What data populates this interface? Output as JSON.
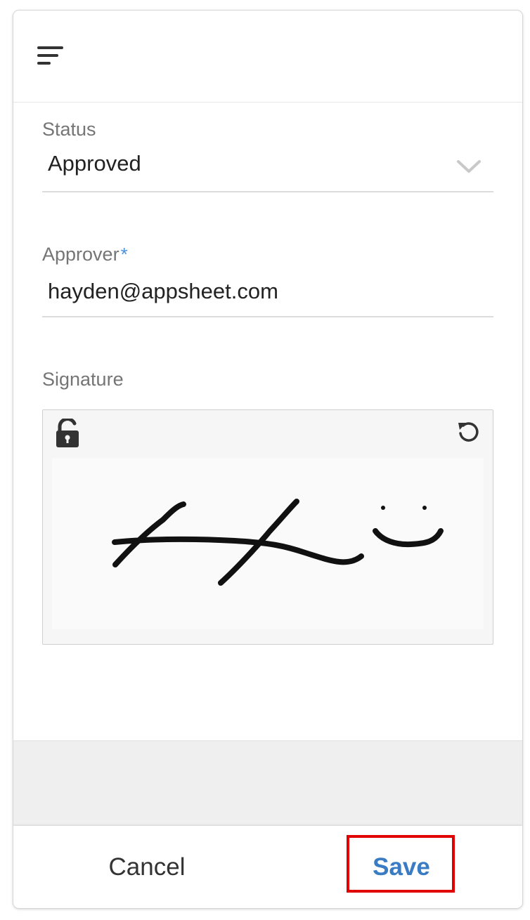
{
  "header": {
    "menu_icon": "menu-icon"
  },
  "form": {
    "status": {
      "label": "Status",
      "value": "Approved",
      "icon": "chevron-down-icon"
    },
    "approver": {
      "label": "Approver",
      "required_mark": "*",
      "value": "hayden@appsheet.com"
    },
    "signature": {
      "label": "Signature",
      "lock_icon": "unlock-icon",
      "reset_icon": "undo-icon"
    }
  },
  "footer": {
    "cancel_label": "Cancel",
    "save_label": "Save"
  },
  "colors": {
    "accent": "#3a7cc4",
    "required": "#4a90d9",
    "highlight": "#e00000"
  }
}
